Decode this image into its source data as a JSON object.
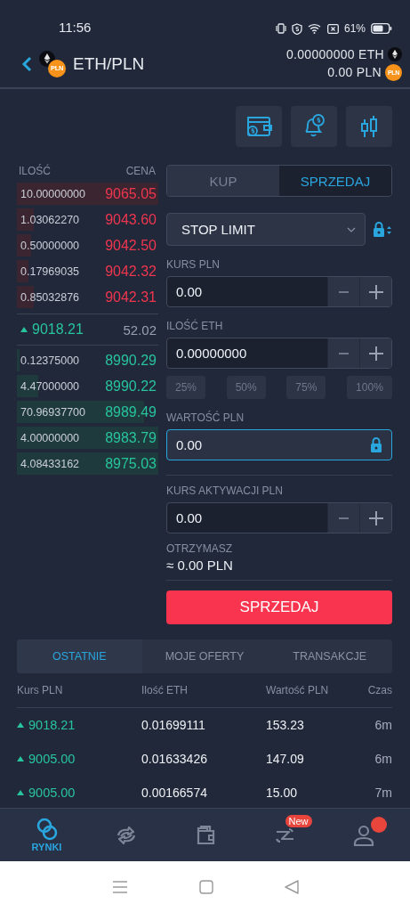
{
  "status_bar": {
    "time": "11:56",
    "battery": "61%"
  },
  "header": {
    "pair": "ETH/PLN",
    "pair_badge": "PLN",
    "balances": [
      {
        "kind": "eth",
        "amount": "0.00000000 ETH"
      },
      {
        "kind": "pln",
        "amount": "0.00 PLN",
        "badge": "PLN"
      }
    ]
  },
  "order_book": {
    "columns": [
      "ILOŚĆ",
      "CENA"
    ],
    "asks": [
      {
        "amount": "10.00000000",
        "price": "9065.05"
      },
      {
        "amount": "1.03062270",
        "price": "9043.60"
      },
      {
        "amount": "0.50000000",
        "price": "9042.50"
      },
      {
        "amount": "0.17969035",
        "price": "9042.32"
      },
      {
        "amount": "0.85032876",
        "price": "9042.31"
      }
    ],
    "last_trade": {
      "price": "9018.21",
      "change": "52.02",
      "rising": true
    },
    "bids": [
      {
        "amount": "0.12375000",
        "price": "8990.29"
      },
      {
        "amount": "4.47000000",
        "price": "8990.22"
      },
      {
        "amount": "70.96937700",
        "price": "8989.49"
      },
      {
        "amount": "4.00000000",
        "price": "8983.79"
      },
      {
        "amount": "4.08433162",
        "price": "8975.03"
      }
    ]
  },
  "order_form": {
    "side_tabs": [
      {
        "label": "KUP",
        "selected": false
      },
      {
        "label": "SPRZEDAJ",
        "selected": true
      }
    ],
    "order_type": "STOP LIMIT",
    "fields": [
      {
        "label": "KURS PLN",
        "value": "0.00",
        "kind": "stepper",
        "focused": false,
        "divider_before": false
      },
      {
        "label": "ILOŚĆ ETH",
        "value": "0.00000000",
        "kind": "stepper",
        "focused": false,
        "divider_before": false,
        "presets": [
          "25%",
          "50%",
          "75%",
          "100%"
        ]
      },
      {
        "label": "WARTOŚĆ PLN",
        "value": "0.00",
        "kind": "locked",
        "focused": true,
        "divider_before": false
      },
      {
        "label": "KURS AKTYWACJI PLN",
        "value": "0.00",
        "kind": "stepper",
        "focused": false,
        "divider_before": true
      }
    ],
    "receive": {
      "label": "OTRZYMASZ",
      "value": "≈ 0.00 PLN"
    },
    "submit": "SPRZEDAJ"
  },
  "history": {
    "tabs": [
      {
        "label": "OSTATNIE",
        "selected": true
      },
      {
        "label": "MOJE OFERTY",
        "selected": false
      },
      {
        "label": "TRANSAKCJE",
        "selected": false
      }
    ],
    "columns": [
      "Kurs PLN",
      "Ilość ETH",
      "Wartość PLN",
      "Czas"
    ],
    "rows": [
      {
        "price": "9018.21",
        "amount": "0.01699111",
        "value": "153.23",
        "time": "6m",
        "rising": true
      },
      {
        "price": "9005.00",
        "amount": "0.01633426",
        "value": "147.09",
        "time": "6m",
        "rising": true
      },
      {
        "price": "9005.00",
        "amount": "0.00166574",
        "value": "15.00",
        "time": "7m",
        "rising": true
      }
    ]
  },
  "bottom_nav": [
    {
      "kind": "markets",
      "label": "RYNKI",
      "selected": true,
      "notification": false
    },
    {
      "kind": "exchange",
      "selected": false,
      "notification": false
    },
    {
      "kind": "wallet",
      "selected": false,
      "notification": false
    },
    {
      "kind": "transfer",
      "selected": false,
      "notification": false,
      "badge": "New"
    },
    {
      "kind": "profile",
      "selected": false,
      "notification": true
    }
  ]
}
